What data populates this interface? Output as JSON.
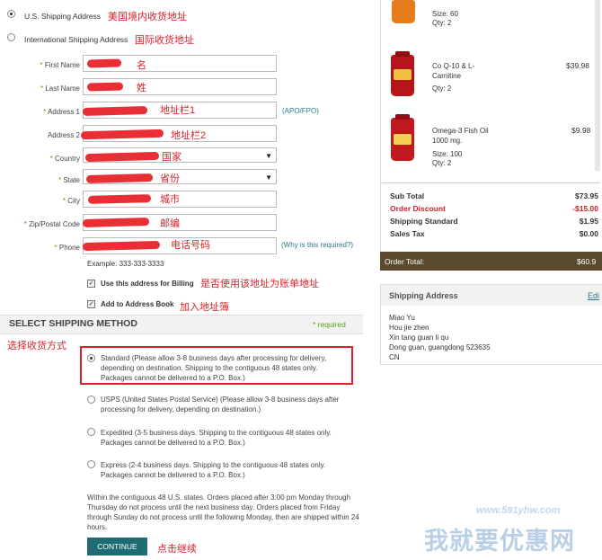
{
  "shipping_type": {
    "us_label": "U.S. Shipping Address",
    "us_note": "美国境内收货地址",
    "intl_label": "International Shipping Address",
    "intl_note": "国际收货地址",
    "selected": "us"
  },
  "form": {
    "first_name": {
      "label": "First Name",
      "note": "名"
    },
    "last_name": {
      "label": "Last Name",
      "note": "姓"
    },
    "address1": {
      "label": "Address 1",
      "note": "地址栏1",
      "hint": "(APO/FPO)"
    },
    "address2": {
      "label": "Address 2",
      "note": "地址栏2"
    },
    "country": {
      "label": "Country",
      "note": "国家"
    },
    "state": {
      "label": "State",
      "note": "省份"
    },
    "city": {
      "label": "City",
      "note": "城市"
    },
    "zip": {
      "label": "Zip/Postal Code",
      "note": "邮编"
    },
    "phone": {
      "label": "Phone",
      "note": "电话号码",
      "hint": "(Why is this required?)",
      "example": "Example: 333-333-3333"
    },
    "use_billing": {
      "label": "Use this address for Billing",
      "note": "是否使用该地址为账单地址",
      "checked": true
    },
    "add_book": {
      "label": "Add to Address Book",
      "note": "加入地址簿",
      "checked": true
    }
  },
  "shipping_method": {
    "title": "SELECT SHIPPING METHOD",
    "required": "* required",
    "note": "选择收货方式",
    "options": [
      {
        "text": "Standard (Please allow 3-8 business days after processing for delivery, depending on destination. Shipping to the contiguous 48 states only. Packages cannot be delivered to a P.O. Box.)",
        "selected": true
      },
      {
        "text": "USPS (United States Postal Service) (Please allow 3-8 business days after processing for delivery, depending on destination.)",
        "selected": false
      },
      {
        "text": "Expedited (3-5 business days. Shipping to the contiguous 48 states only. Packages cannot be delivered to a P.O. Box.)",
        "selected": false
      },
      {
        "text": "Express (2-4 business days. Shipping to the contiguous 48 states only. Packages cannot be delivered to a P.O. Box.)",
        "selected": false
      }
    ],
    "footnote": "Within the contiguous 48 U.S. states. Orders placed after 3:00 pm Monday through Thursday do not process until the next business day. Orders placed from Friday through Sunday do not process until the following Monday, then are shipped within 24 hours."
  },
  "continue": {
    "label": "CONTINUE",
    "note": "点击继续"
  },
  "cart": {
    "items": [
      {
        "name": "",
        "size": "Size: 60",
        "qty": "Qty: 2",
        "price": ""
      },
      {
        "name": "Co Q-10 & L-Carnitine",
        "size": "",
        "qty": "Qty: 2",
        "price": "$39.98"
      },
      {
        "name": "Omega-3 Fish Oil 1000 mg.",
        "size": "Size: 100",
        "qty": "Qty: 2",
        "price": "$9.98"
      }
    ],
    "summary": [
      {
        "label": "Sub Total",
        "value": "$73.95",
        "color": "#222"
      },
      {
        "label": "Order Discount",
        "value": "-$15.00",
        "color": "#c8202a"
      },
      {
        "label": "Shipping Standard",
        "value": "$1.95",
        "color": "#222"
      },
      {
        "label": "Sales Tax",
        "value": "$0.00",
        "color": "#222"
      }
    ],
    "total_label": "Order Total:",
    "total_value": "$60.9"
  },
  "shipping_address": {
    "title": "Shipping Address",
    "edit": "Edi",
    "lines": [
      "Miao Yu",
      "Hou jie zhen",
      "Xin tang guan li qu",
      "Dong guan, guangdong 523635",
      "CN"
    ]
  },
  "watermark": {
    "url": "www.591yhw.com",
    "brand": "我就要优惠网"
  },
  "colors": {
    "accent_red": "#d9232a",
    "button": "#1f6b74",
    "total_bar": "#5b4a2e"
  }
}
